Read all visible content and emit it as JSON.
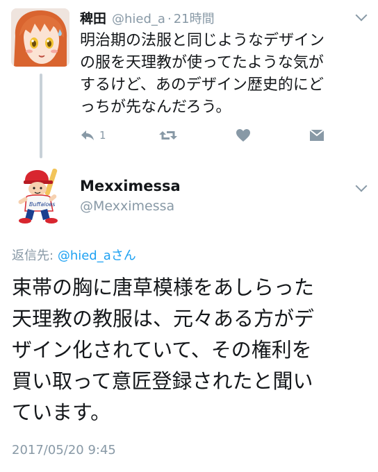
{
  "parent_tweet": {
    "display_name": "稗田",
    "handle": "@hied_a",
    "separator": "·",
    "time": "21時間",
    "text_lines": [
      "明治期の法服と同じようなデザイン",
      "の服を天理教が使ってたような気が",
      "するけど、あのデザイン歴史的にど",
      "っちが先なんだろう。"
    ],
    "reply_count": "1",
    "icons": [
      "reply-icon",
      "retweet-icon",
      "like-icon",
      "direct-message-icon"
    ]
  },
  "main_tweet": {
    "display_name": "Mexximessa",
    "handle": "@Mexximessa",
    "reply_prefix": "返信先:",
    "reply_mention": "@hied_aさん",
    "text_lines": [
      "束帯の胸に唐草模様をあしらった",
      "天理教の教服は、元々ある方がデ",
      "ザイン化されていて、その権利を",
      "買い取って意匠登録されたと聞い",
      "ています。"
    ],
    "timestamp": "2017/05/20 9:45"
  },
  "colors": {
    "text_primary": "#14171a",
    "text_secondary": "#8899a6",
    "link": "#1da1f2",
    "thread_line": "#c8d1d8"
  }
}
